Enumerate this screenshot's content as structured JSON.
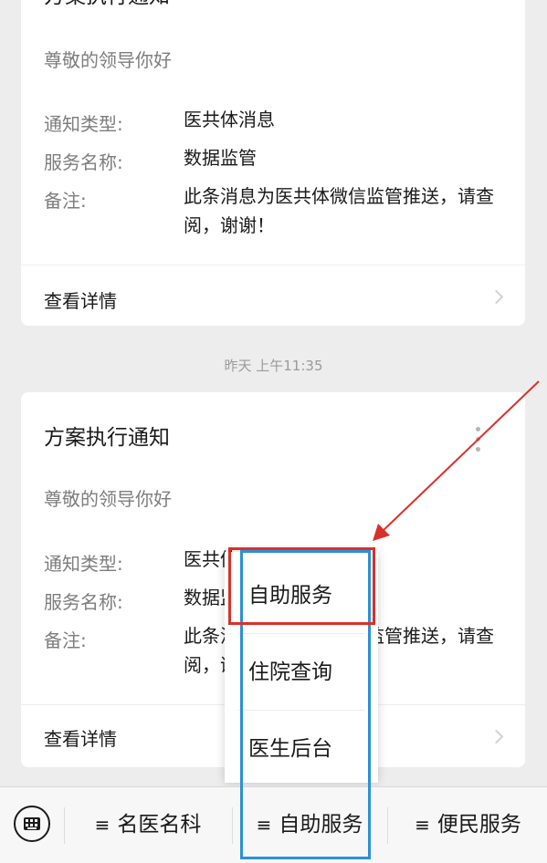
{
  "cards": [
    {
      "title": "方案执行通知",
      "greeting": "尊敬的领导你好",
      "fields": [
        {
          "label": "通知类型:",
          "value": "医共体消息"
        },
        {
          "label": "服务名称:",
          "value": "数据监管"
        },
        {
          "label": "备注:",
          "value": "此条消息为医共体微信监管推送，请查阅，谢谢！"
        }
      ],
      "detail_link": "查看详情"
    },
    {
      "title": "方案执行通知",
      "greeting": "尊敬的领导你好",
      "fields": [
        {
          "label": "通知类型:",
          "value": "医共体消息"
        },
        {
          "label": "服务名称:",
          "value": "数据监管"
        },
        {
          "label": "备注:",
          "value": "此条消息为医共体微信监管推送，请查阅，谢谢！"
        }
      ],
      "detail_link": "查看详情"
    }
  ],
  "timestamp": "昨天 上午11:35",
  "menu": {
    "items": [
      {
        "glyph": "≡",
        "label": "名医名科"
      },
      {
        "glyph": "≡",
        "label": "自助服务"
      },
      {
        "glyph": "≡",
        "label": "便民服务"
      }
    ],
    "submenu": [
      "自助服务",
      "住院查询",
      "医生后台"
    ]
  },
  "icons": {
    "keyboard": "keyboard-icon",
    "more": "more-vertical-icon",
    "chevron": "chevron-right-icon"
  },
  "colors": {
    "background": "#ededed",
    "card": "#ffffff",
    "annotation_red": "#d9302a",
    "annotation_blue": "#2e8fd6"
  }
}
